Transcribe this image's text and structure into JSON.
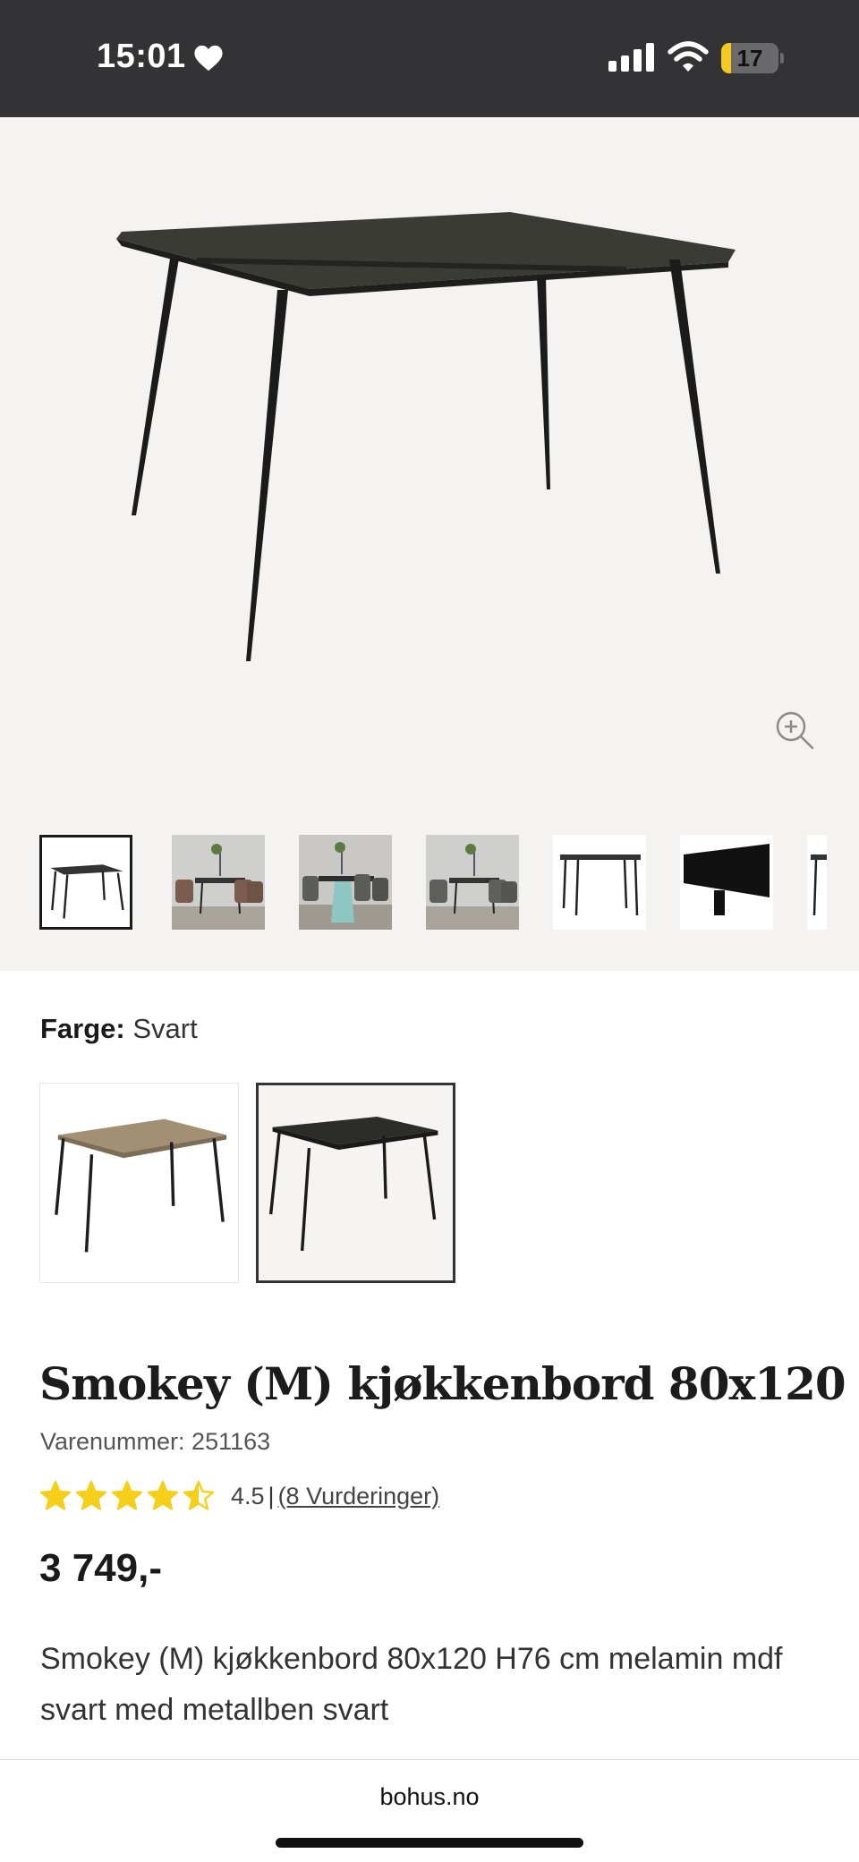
{
  "status_bar": {
    "time": "15:01",
    "battery_level": "17",
    "battery_fraction": 0.17,
    "time_icon": "heart-icon",
    "icons": [
      "signal-icon",
      "wifi-icon",
      "battery-icon"
    ]
  },
  "gallery": {
    "thumbnails": [
      {
        "kind": "table-product",
        "selected": true
      },
      {
        "kind": "room-scene",
        "selected": false
      },
      {
        "kind": "room-scene",
        "selected": false
      },
      {
        "kind": "room-scene",
        "selected": false
      },
      {
        "kind": "table-product",
        "selected": false
      },
      {
        "kind": "tabletop-detail",
        "selected": false
      },
      {
        "kind": "partial",
        "selected": false
      }
    ],
    "zoom_icon": "zoom-in-icon"
  },
  "color": {
    "label": "Farge:",
    "value": "Svart",
    "variants": [
      {
        "finish": "oak",
        "selected": false
      },
      {
        "finish": "black",
        "selected": true
      }
    ]
  },
  "product": {
    "title": "Smokey (M) kjøkkenbord 80x120",
    "sku": "Varenummer: 251163",
    "rating": {
      "value": "4.5",
      "stars": 4.5,
      "separator": "|",
      "count_text": "(8 Vurderinger)"
    },
    "price": "3 749,-",
    "description": "Smokey (M) kjøkkenbord 80x120 H76 cm melamin mdf svart med metallben svart"
  },
  "browser": {
    "url": "bohus.no"
  },
  "colors": {
    "status_bar_bg": "#333335",
    "gallery_bg": "#f4f3f1",
    "star": "#f6cf1b",
    "battery": "#f4c721"
  }
}
